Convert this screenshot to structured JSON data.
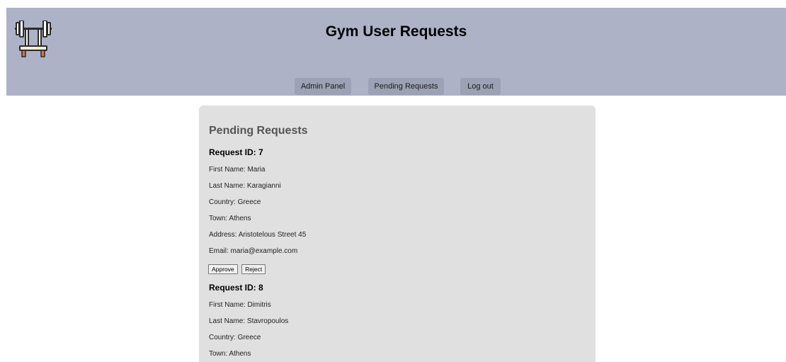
{
  "header": {
    "title": "Gym User Requests",
    "logo_icon": "barbell-bench-icon"
  },
  "nav": {
    "admin_panel": "Admin Panel",
    "pending_requests": "Pending Requests",
    "log_out": "Log out"
  },
  "colors": {
    "header_bg": "#adb2c6",
    "nav_btn_bg": "#9ca1b5",
    "card_bg": "#e0e0e0"
  },
  "main": {
    "section_title": "Pending Requests",
    "requests": [
      {
        "id_label": "Request ID: 7",
        "first_name": "First Name: Maria",
        "last_name": "Last Name: Karagianni",
        "country": "Country: Greece",
        "town": "Town: Athens",
        "address": "Address: Aristotelous Street 45",
        "email": "Email: maria@example.com",
        "approve_label": "Approve",
        "reject_label": "Reject"
      },
      {
        "id_label": "Request ID: 8",
        "first_name": "First Name: Dimitris",
        "last_name": "Last Name: Stavropoulos",
        "country": "Country: Greece",
        "town": "Town: Athens"
      }
    ]
  }
}
